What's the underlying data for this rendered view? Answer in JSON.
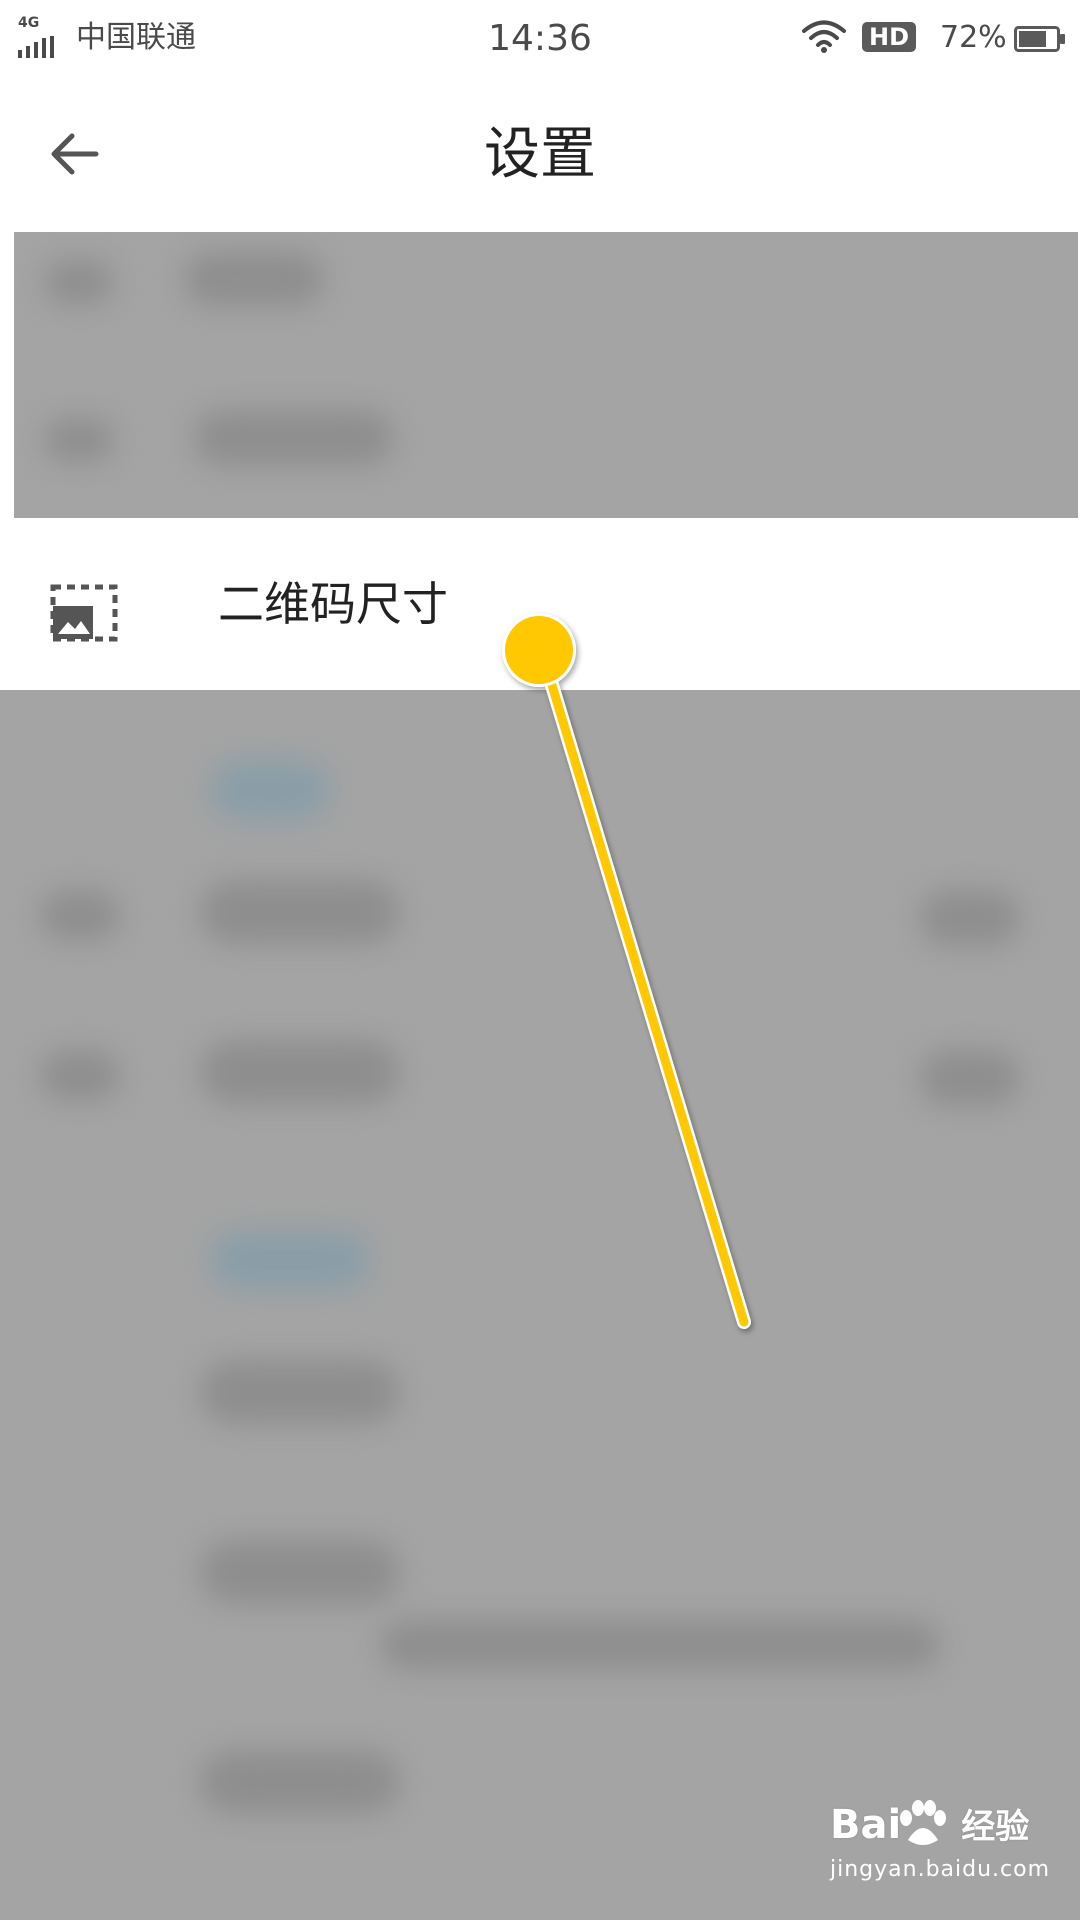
{
  "status_bar": {
    "network_type": "4G",
    "carrier": "中国联通",
    "time": "14:36",
    "hd_badge": "HD",
    "battery_percent": "72%",
    "battery_level": 0.72,
    "icons": [
      "signal-icon",
      "wifi-icon",
      "battery-icon"
    ]
  },
  "title_bar": {
    "title": "设置",
    "back_icon": "arrow-left-icon"
  },
  "settings": {
    "qr_size": {
      "label": "二维码尺寸",
      "icon": "image-frame-icon"
    }
  },
  "overlay": {
    "dim_color": "#a4a4a4",
    "pointer_color": "#ffc800"
  },
  "watermark": {
    "brand_prefix": "Bai",
    "brand_suffix": "经验",
    "url": "jingyan.baidu.com"
  }
}
